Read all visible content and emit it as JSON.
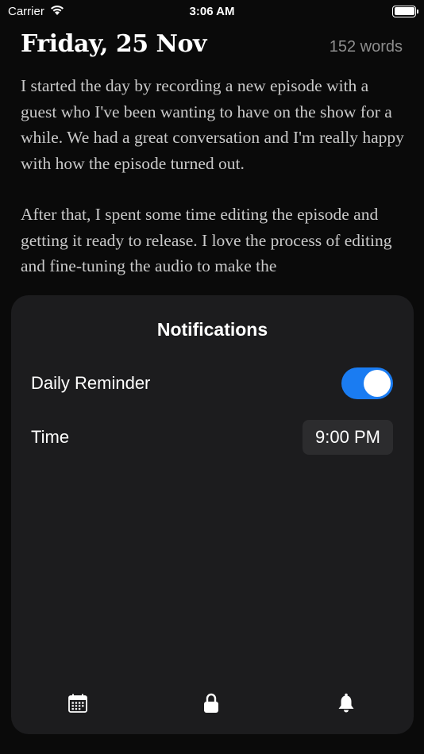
{
  "status_bar": {
    "carrier": "Carrier",
    "time": "3:06 AM",
    "battery_level": 1.0
  },
  "entry": {
    "date": "Friday, 25 Nov",
    "word_count": "152 words",
    "paragraphs": [
      "I started the day by recording a new episode with a guest who I've been wanting to have on the show for a while. We had a great conversation and I'm really happy with how the episode turned out.",
      "After that, I spent some time editing the episode and getting it ready to release. I love the process of editing and fine-tuning the audio to make the"
    ]
  },
  "notifications_sheet": {
    "title": "Notifications",
    "daily_reminder": {
      "label": "Daily Reminder",
      "enabled": true,
      "accent_color": "#1a7cf2"
    },
    "time": {
      "label": "Time",
      "value": "9:00 PM"
    }
  },
  "tab_bar": {
    "tabs": [
      {
        "icon": "calendar-icon"
      },
      {
        "icon": "lock-icon"
      },
      {
        "icon": "bell-icon"
      }
    ]
  }
}
